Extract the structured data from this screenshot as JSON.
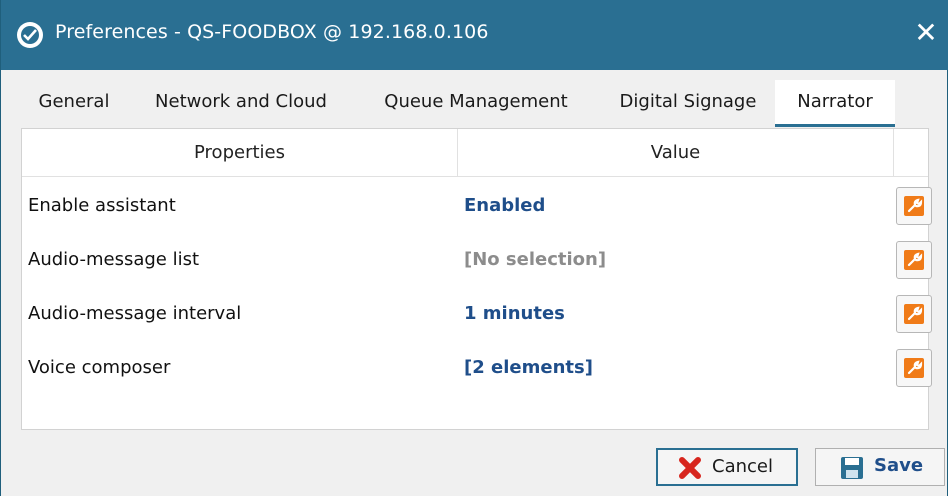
{
  "window": {
    "title": "Preferences - QS-FOODBOX @ 192.168.0.106",
    "close_glyph": "✕",
    "icon": "app-logo-icon"
  },
  "tabs": [
    {
      "label": "General",
      "active": false
    },
    {
      "label": "Network and Cloud",
      "active": false
    },
    {
      "label": "Queue Management",
      "active": false
    },
    {
      "label": "Digital Signage",
      "active": false
    },
    {
      "label": "Narrator",
      "active": true
    }
  ],
  "grid": {
    "headers": {
      "properties": "Properties",
      "value": "Value"
    },
    "rows": [
      {
        "property": "Enable assistant",
        "value": "Enabled",
        "muted": false
      },
      {
        "property": "Audio-message list",
        "value": "[No selection]",
        "muted": true
      },
      {
        "property": "Audio-message interval",
        "value": "1 minutes",
        "muted": false
      },
      {
        "property": "Voice composer",
        "value": "[2 elements]",
        "muted": false
      }
    ],
    "edit_icon": "wrench-icon"
  },
  "buttons": {
    "cancel": "Cancel",
    "save": "Save"
  },
  "colors": {
    "titlebar": "#2a6f92",
    "value_text": "#1f4e8a",
    "muted_value": "#8c8c8c",
    "edit_icon": "#f07b18",
    "cancel_icon": "#d7261e",
    "save_icon": "#2a6f92"
  }
}
